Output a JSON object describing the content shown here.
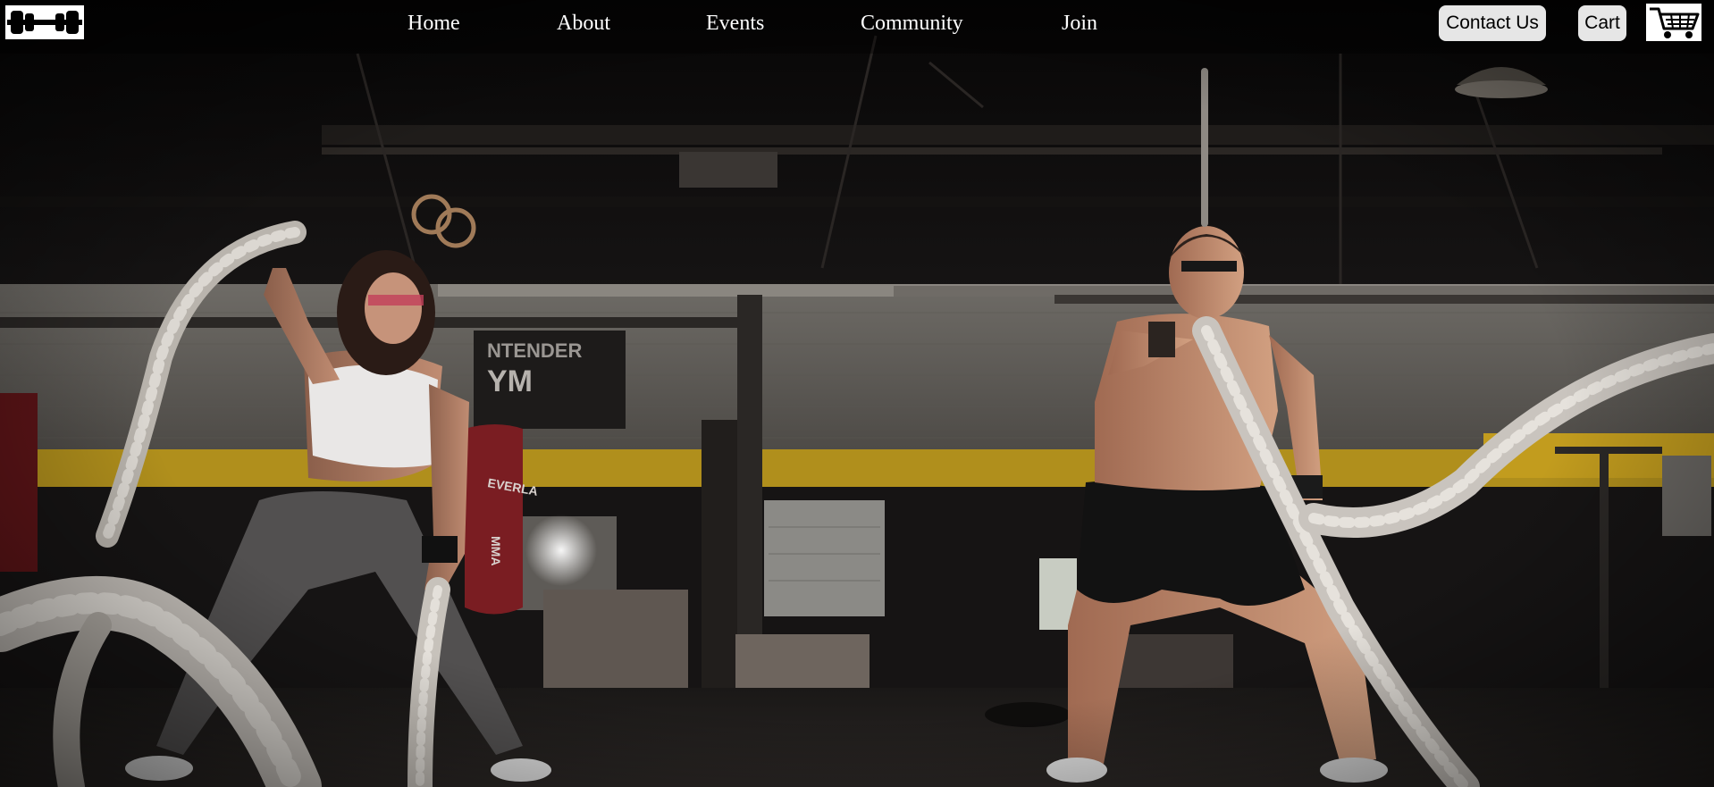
{
  "brand": {
    "logo_icon": "dumbbell-icon"
  },
  "nav": {
    "items": [
      {
        "label": "Home"
      },
      {
        "label": "About"
      },
      {
        "label": "Events"
      },
      {
        "label": "Community"
      },
      {
        "label": "Join"
      }
    ]
  },
  "actions": {
    "contact_label": "Contact Us",
    "cart_label": "Cart",
    "cart_icon": "shopping-cart-icon"
  },
  "hero": {
    "image_description_icon": "gym-battle-ropes-photo",
    "wall_sign_text": "NTENDER YM",
    "bag_text": "EVERLAST MMA"
  },
  "colors": {
    "nav_text": "#ffffff",
    "button_bg": "#e6e6e6",
    "background": "#0a0909",
    "wall_stripe": "#b08f1c"
  }
}
